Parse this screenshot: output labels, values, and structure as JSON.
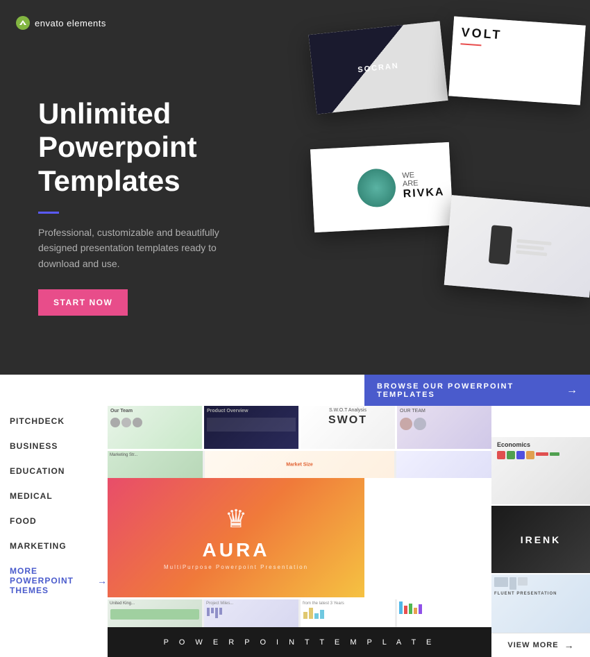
{
  "logo": {
    "text": "envato elements"
  },
  "hero": {
    "title": "Unlimited Powerpoint Templates",
    "subtitle": "Professional, customizable and beautifully designed presentation templates ready to download and use.",
    "cta_label": "START NOW",
    "card_labels": {
      "socran": "SOCRAN",
      "volt": "VOLT",
      "rivka": "WE ARE RIVKA"
    }
  },
  "browse": {
    "banner_text": "BROWSE OUR POWERPOINT TEMPLATES"
  },
  "nav": {
    "items": [
      {
        "label": "PITCHDECK"
      },
      {
        "label": "BUSINESS"
      },
      {
        "label": "EDUCATION"
      },
      {
        "label": "MEDICAL"
      },
      {
        "label": "FOOD"
      },
      {
        "label": "MARKETING"
      }
    ],
    "more_label": "MORE POWERPOINT THEMES"
  },
  "featured": {
    "aura_title": "AURA",
    "aura_subtitle": "MultiPurpose Powerpoint Presentation",
    "strip_text": "P O W E R P O I N T   T E M P L A T E",
    "swot_label": "S.W.O.T",
    "our_team_label": "OUR TEAM",
    "economics_label": "Economics",
    "irenk_label": "IRENK",
    "fluent_label": "FLUENT PRESENTATION",
    "view_more_label": "VIEW MORE"
  }
}
